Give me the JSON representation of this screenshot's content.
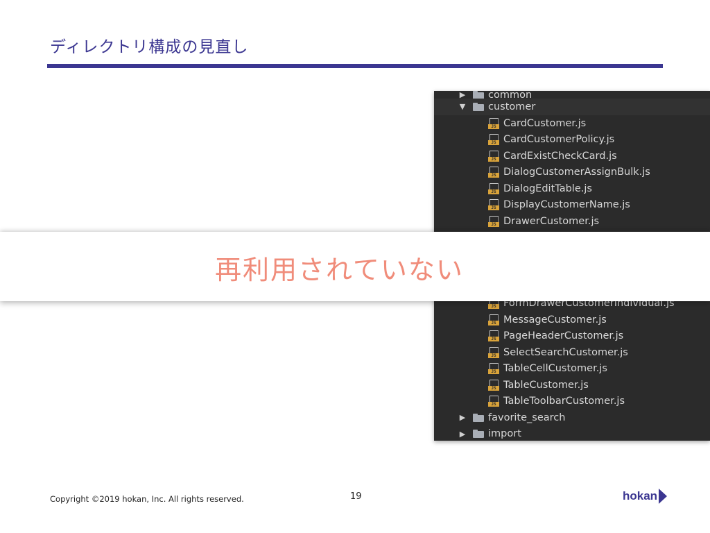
{
  "slide": {
    "title": "ディレクトリ構成の見直し",
    "overlay_text": "再利用されていない",
    "copyright": "Copyright ©2019 hokan, Inc. All rights reserved.",
    "page_number": "19",
    "logo_text": "hokan"
  },
  "colors": {
    "accent": "#3b3691",
    "overlay_text": "#f08c7a",
    "tree_background": "#2b2b2b",
    "js_badge": "#d9a33a"
  },
  "file_tree": {
    "items": [
      {
        "type": "folder",
        "label": "common",
        "state": "collapsed-partial"
      },
      {
        "type": "folder",
        "label": "customer",
        "state": "expanded"
      },
      {
        "type": "file",
        "label": "CardCustomer.js",
        "icon": "js-file-icon"
      },
      {
        "type": "file",
        "label": "CardCustomerPolicy.js",
        "icon": "js-file-icon"
      },
      {
        "type": "file",
        "label": "CardExistCheckCard.js",
        "icon": "js-file-icon"
      },
      {
        "type": "file",
        "label": "DialogCustomerAssignBulk.js",
        "icon": "js-file-icon"
      },
      {
        "type": "file",
        "label": "DialogEditTable.js",
        "icon": "js-file-icon"
      },
      {
        "type": "file",
        "label": "DisplayCustomerName.js",
        "icon": "js-file-icon"
      },
      {
        "type": "file",
        "label": "DrawerCustomer.js",
        "icon": "js-file-icon"
      },
      {
        "type": "file",
        "label": "FormDrawerCustomerIndividual.js",
        "icon": "js-file-icon"
      },
      {
        "type": "file",
        "label": "MessageCustomer.js",
        "icon": "js-file-icon"
      },
      {
        "type": "file",
        "label": "PageHeaderCustomer.js",
        "icon": "js-file-icon"
      },
      {
        "type": "file",
        "label": "SelectSearchCustomer.js",
        "icon": "js-file-icon"
      },
      {
        "type": "file",
        "label": "TableCellCustomer.js",
        "icon": "js-file-icon"
      },
      {
        "type": "file",
        "label": "TableCustomer.js",
        "icon": "js-file-icon"
      },
      {
        "type": "file",
        "label": "TableToolbarCustomer.js",
        "icon": "js-file-icon"
      },
      {
        "type": "folder",
        "label": "favorite_search",
        "state": "collapsed"
      },
      {
        "type": "folder",
        "label": "import",
        "state": "collapsed"
      }
    ],
    "js_badge_text": "JS",
    "arrow_expanded": "▼",
    "arrow_collapsed": "▶"
  }
}
